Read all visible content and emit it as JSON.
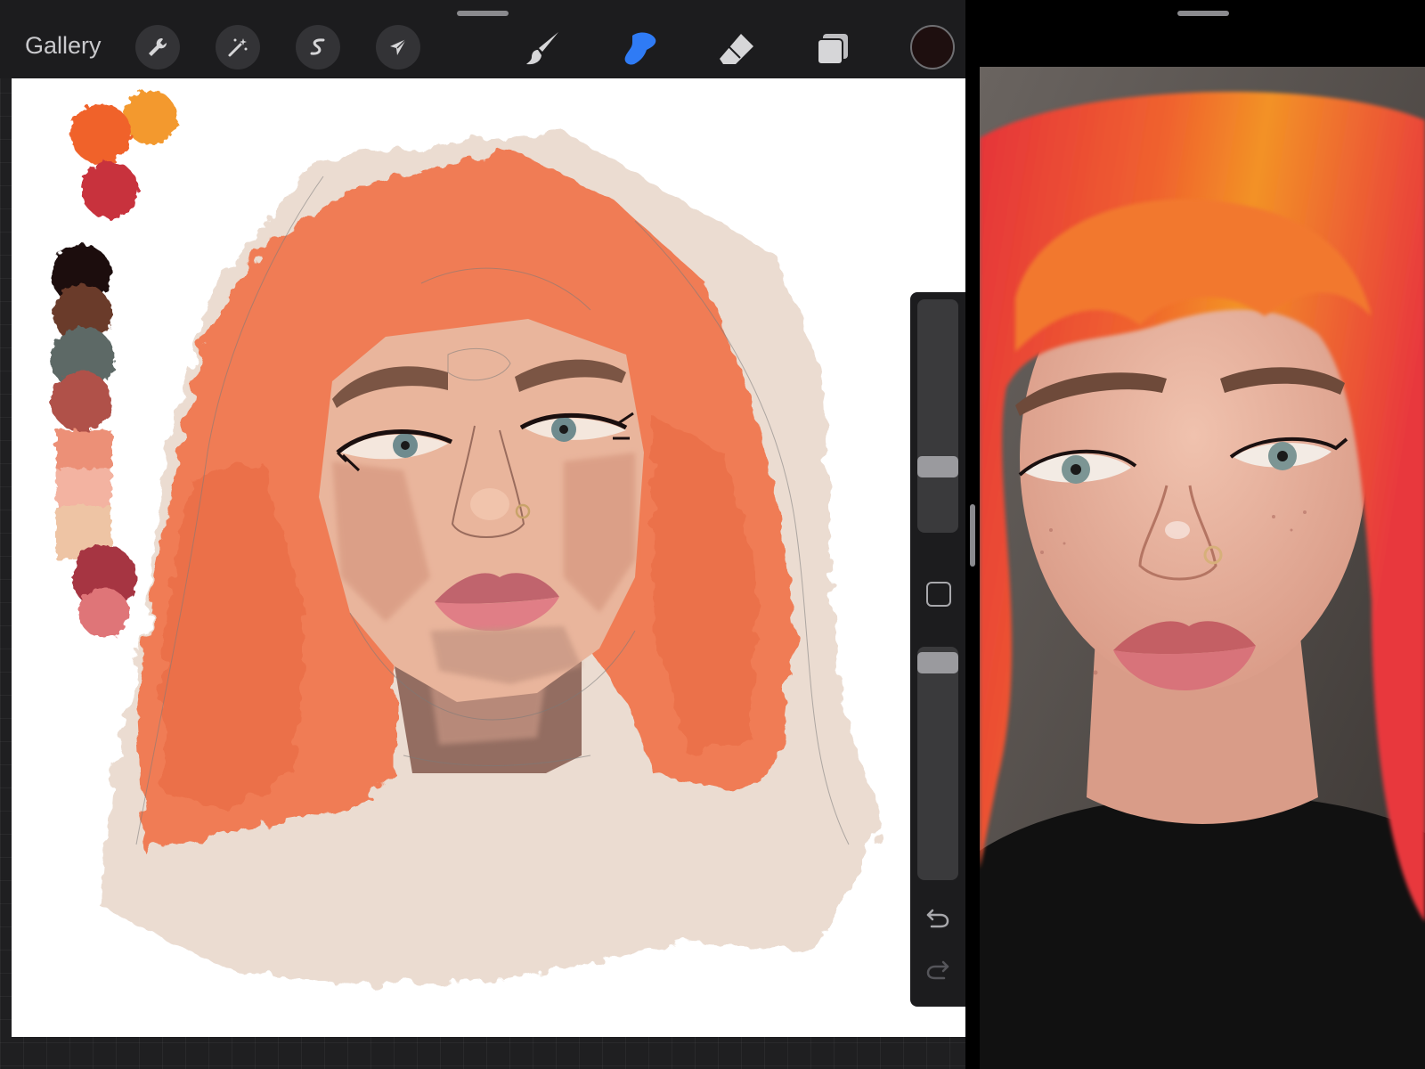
{
  "toolbar": {
    "gallery_label": "Gallery",
    "tools": [
      {
        "name": "actions",
        "icon": "wrench-icon"
      },
      {
        "name": "adjustments",
        "icon": "magic-wand-icon"
      },
      {
        "name": "selection",
        "icon": "selection-s-icon"
      },
      {
        "name": "transform",
        "icon": "arrow-cursor-icon"
      },
      {
        "name": "paint",
        "icon": "brush-icon"
      },
      {
        "name": "smudge",
        "icon": "smudge-finger-icon",
        "active": true
      },
      {
        "name": "erase",
        "icon": "eraser-icon"
      },
      {
        "name": "layers",
        "icon": "layers-icon"
      }
    ],
    "active_color": "#1e0f0f",
    "active_tool_color": "#2f7bf5"
  },
  "palette": {
    "swatches": [
      "#f3992f",
      "#f0622c",
      "#c8313d",
      "#1a0b0b",
      "#6b3a2a",
      "#5d6966",
      "#b0514a",
      "#ec9077",
      "#f3b3a1",
      "#eec4a4",
      "#a63542",
      "#df7478"
    ]
  },
  "sidebar": {
    "brush_size_level": 0.72,
    "opacity_level": 0.02,
    "modify_icon": "modify-square-icon",
    "undo_icon": "undo-icon",
    "redo_icon": "redo-icon"
  },
  "reference": {
    "icon": "reference-photo"
  }
}
